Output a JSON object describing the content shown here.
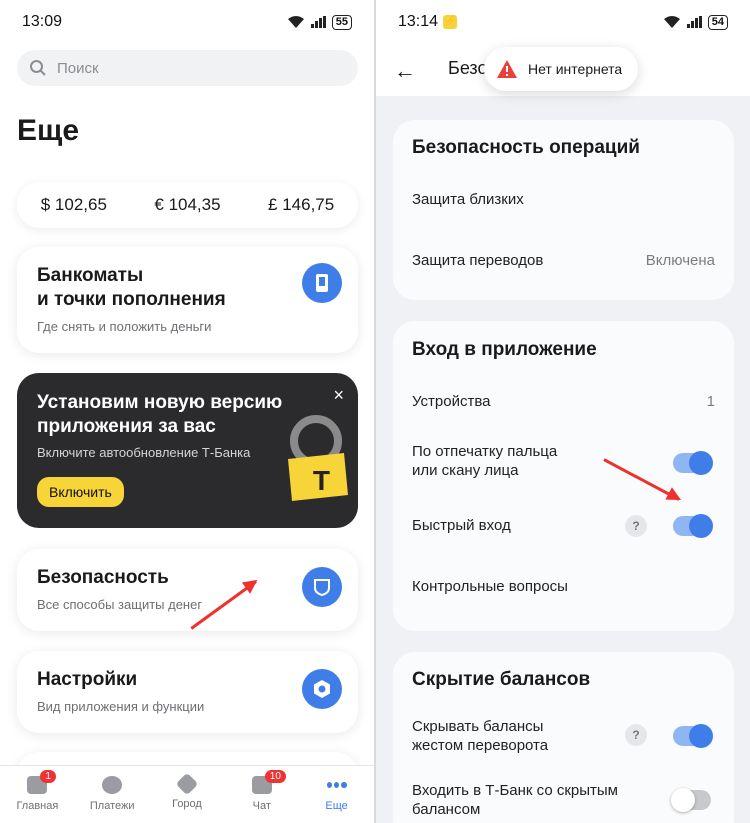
{
  "left": {
    "status": {
      "time": "13:09",
      "battery": "55"
    },
    "search_placeholder": "Поиск",
    "title": "Еще",
    "currencies": [
      "$ 102,65",
      "€ 104,35",
      "£ 146,75"
    ],
    "atm_card": {
      "title_line1": "Банкоматы",
      "title_line2": "и точки пополнения",
      "subtitle": "Где снять и положить деньги"
    },
    "promo": {
      "title": "Установим новую версию приложения за вас",
      "subtitle": "Включите автообновление Т-Банка",
      "button": "Включить",
      "close": "×",
      "lock_letter": "T"
    },
    "security_card": {
      "title": "Безопасность",
      "subtitle": "Все способы защиты денег"
    },
    "settings_card": {
      "title": "Настройки",
      "subtitle": "Вид приложения и функции"
    },
    "nav": [
      {
        "label": "Главная",
        "badge": "1"
      },
      {
        "label": "Платежи",
        "badge": ""
      },
      {
        "label": "Город",
        "badge": ""
      },
      {
        "label": "Чат",
        "badge": "10"
      },
      {
        "label": "Еще",
        "badge": ""
      }
    ]
  },
  "right": {
    "status": {
      "time": "13:14",
      "battery": "54"
    },
    "title_partial": "Безо",
    "toast": "Нет интернета",
    "sections": {
      "ops": {
        "title": "Безопасность операций",
        "row1": "Защита близких",
        "row2": "Защита переводов",
        "row2_value": "Включена"
      },
      "login": {
        "title": "Вход в приложение",
        "row1": "Устройства",
        "row1_value": "1",
        "row2_line1": "По отпечатку пальца",
        "row2_line2": "или скану лица",
        "row3": "Быстрый вход",
        "row4": "Контрольные вопросы"
      },
      "hide": {
        "title": "Скрытие балансов",
        "row1_line1": "Скрывать балансы",
        "row1_line2": "жестом переворота",
        "row2_line1": "Входить в Т-Банк со скрытым",
        "row2_line2": "балансом"
      }
    },
    "toggles": {
      "fingerprint": "on",
      "quick_login": "on",
      "flip_hide": "on",
      "hidden_login": "off"
    }
  },
  "colors": {
    "accent": "#3f7de8",
    "promo_button": "#f7d437",
    "arrow": "#f0302b",
    "badge": "#ee3333"
  }
}
